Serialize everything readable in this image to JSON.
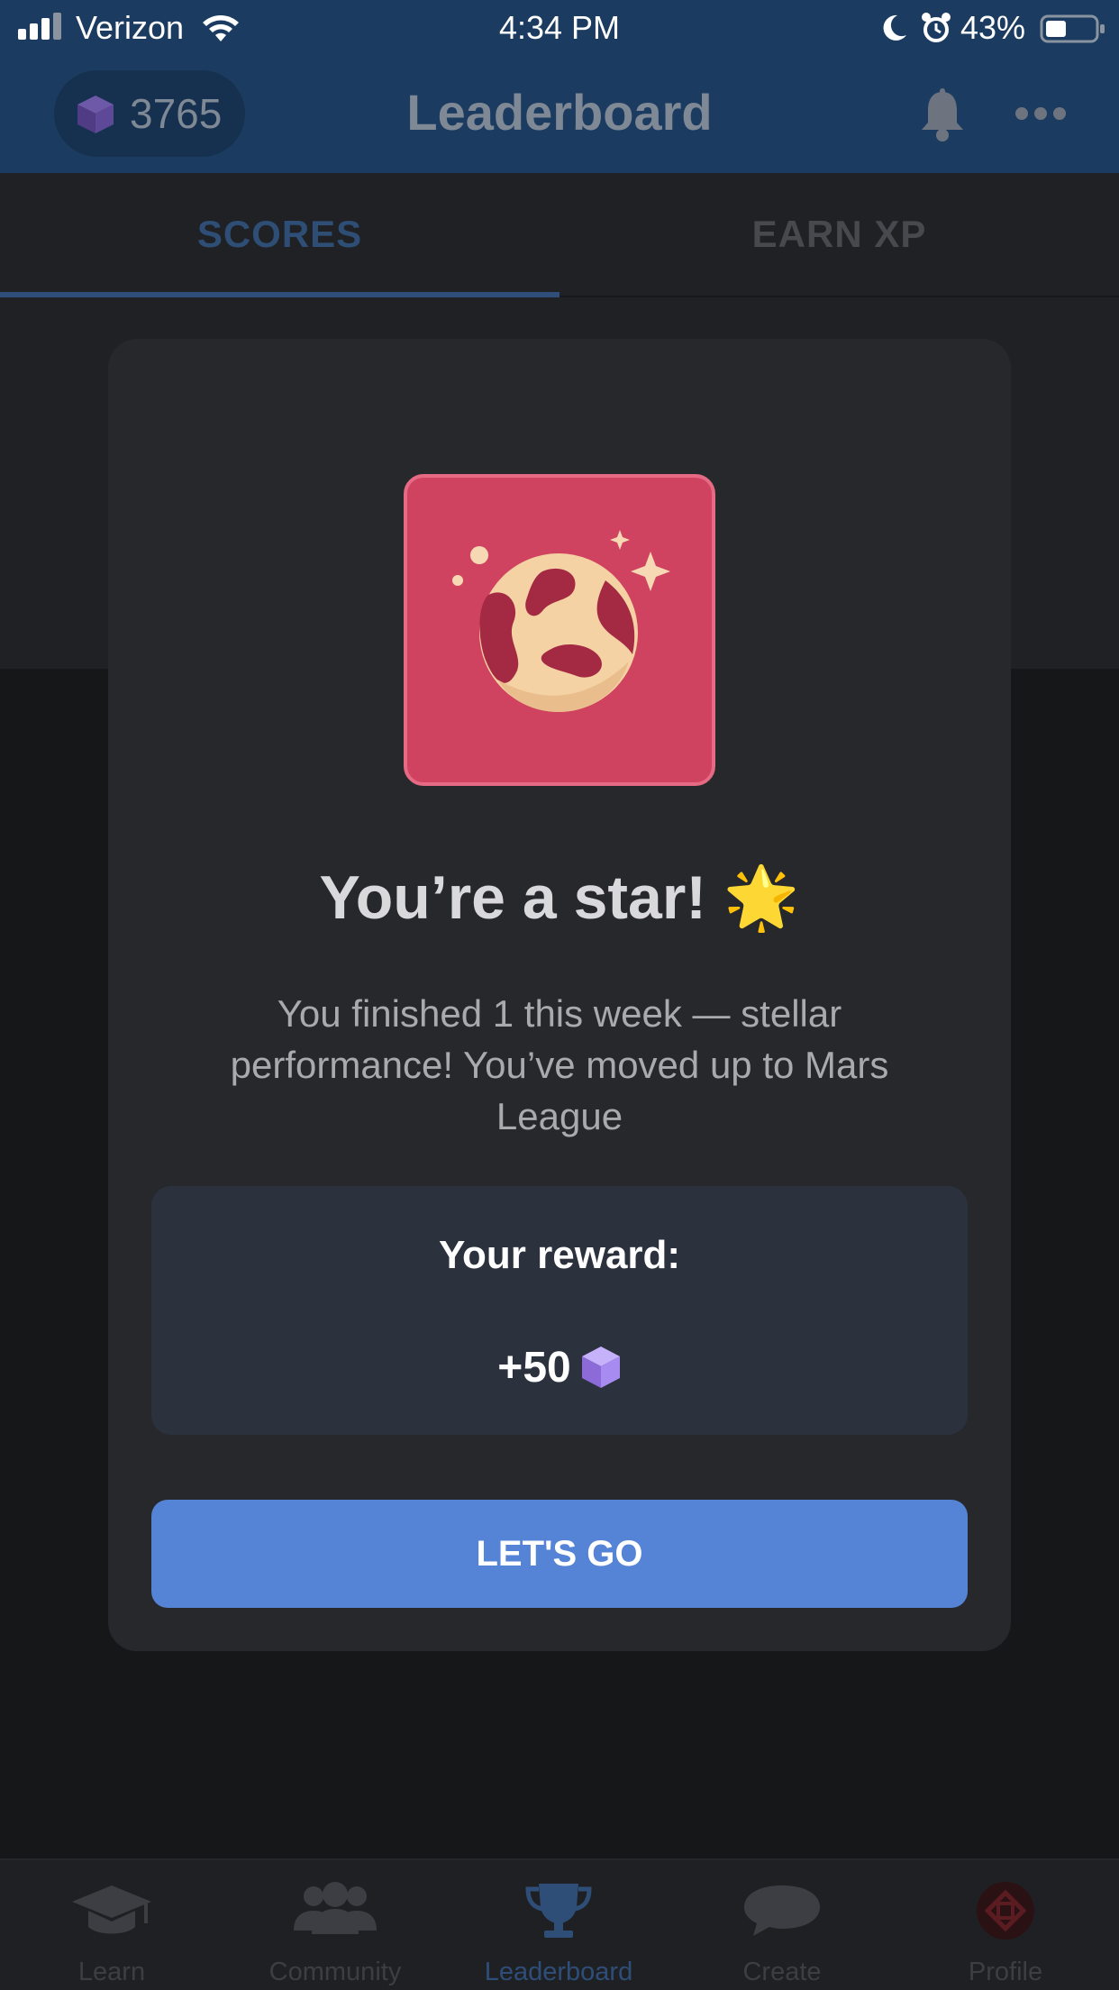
{
  "status_bar": {
    "carrier": "Verizon",
    "time": "4:34 PM",
    "battery": "43%"
  },
  "header": {
    "gem_count": "3765",
    "title": "Leaderboard",
    "icons": [
      "gem-icon",
      "bell-icon",
      "more-icon"
    ]
  },
  "tabs": [
    {
      "label": "SCORES",
      "active": true
    },
    {
      "label": "EARN XP",
      "active": false
    }
  ],
  "modal": {
    "badge_icon": "mars-planet-icon",
    "title": "You’re a star! 🌟",
    "message": "You finished 1 this week — stellar performance! You’ve moved up to Mars League",
    "reward_label": "Your reward:",
    "reward_amount": "+50",
    "reward_icon": "gem-icon",
    "button_label": "LET'S GO"
  },
  "bottom_nav": [
    {
      "label": "Learn",
      "icon": "graduation-cap-icon",
      "active": false
    },
    {
      "label": "Community",
      "icon": "people-icon",
      "active": false
    },
    {
      "label": "Leaderboard",
      "icon": "trophy-icon",
      "active": true
    },
    {
      "label": "Create",
      "icon": "chat-bubble-icon",
      "active": false
    },
    {
      "label": "Profile",
      "icon": "avatar-icon",
      "active": false
    }
  ],
  "colors": {
    "header_bg": "#1b3c60",
    "accent": "#5584d6",
    "badge_bg": "#cf4360",
    "gem": "#9b7ce8"
  }
}
